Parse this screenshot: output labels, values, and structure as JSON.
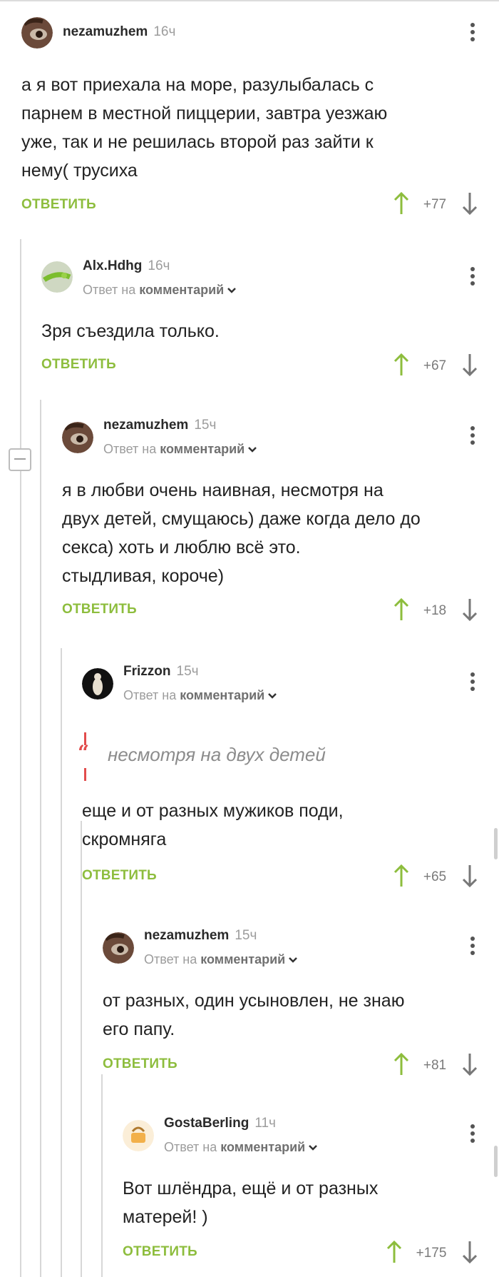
{
  "comments": [
    {
      "username": "nezamuzhem",
      "time": "16ч",
      "text_lines": [
        "а я вот приехала на море, разулыбалась с",
        "парнем в местной пиццерии, завтра уезжаю",
        "уже, так и не решилась второй раз зайти к",
        "нему( трусиха"
      ],
      "reply_label": "ОТВЕТИТЬ",
      "score": "+77"
    },
    {
      "username": "Alx.Hdhg",
      "time": "16ч",
      "reply_prefix": "Ответ на",
      "reply_target": "комментарий",
      "text_lines": [
        "Зря съездила только."
      ],
      "reply_label": "ОТВЕТИТЬ",
      "score": "+67"
    },
    {
      "username": "nezamuzhem",
      "time": "15ч",
      "reply_prefix": "Ответ на",
      "reply_target": "комментарий",
      "text_lines": [
        "я в любви очень наивная, несмотря на",
        "двух детей, смущаюсь) даже когда дело до",
        "секса) хоть и люблю всё это.",
        "стыдливая, короче)"
      ],
      "reply_label": "ОТВЕТИТЬ",
      "score": "+18"
    },
    {
      "username": "Frizzon",
      "time": "15ч",
      "reply_prefix": "Ответ на",
      "reply_target": "комментарий",
      "quote": "несмотря на двух детей",
      "text_lines": [
        "еще и от разных мужиков поди,",
        "скромняга"
      ],
      "reply_label": "ОТВЕТИТЬ",
      "score": "+65"
    },
    {
      "username": "nezamuzhem",
      "time": "15ч",
      "reply_prefix": "Ответ на",
      "reply_target": "комментарий",
      "text_lines": [
        "от разных, один усыновлен, не знаю",
        "его папу."
      ],
      "reply_label": "ОТВЕТИТЬ",
      "score": "+81"
    },
    {
      "username": "GostaBerling",
      "time": "11ч",
      "reply_prefix": "Ответ на",
      "reply_target": "комментарий",
      "text_lines": [
        "Вот шлёндра, ещё и от разных",
        "матерей! )"
      ],
      "reply_label": "ОТВЕТИТЬ",
      "score": "+175"
    }
  ],
  "colors": {
    "accent_green": "#8dbd3d",
    "quote_red": "#e24c4c"
  },
  "icons": [
    "avatar",
    "kebab-menu-icon",
    "chevron-down-icon",
    "arrow-up-icon",
    "arrow-down-icon",
    "quote-icon",
    "collapse-icon"
  ]
}
